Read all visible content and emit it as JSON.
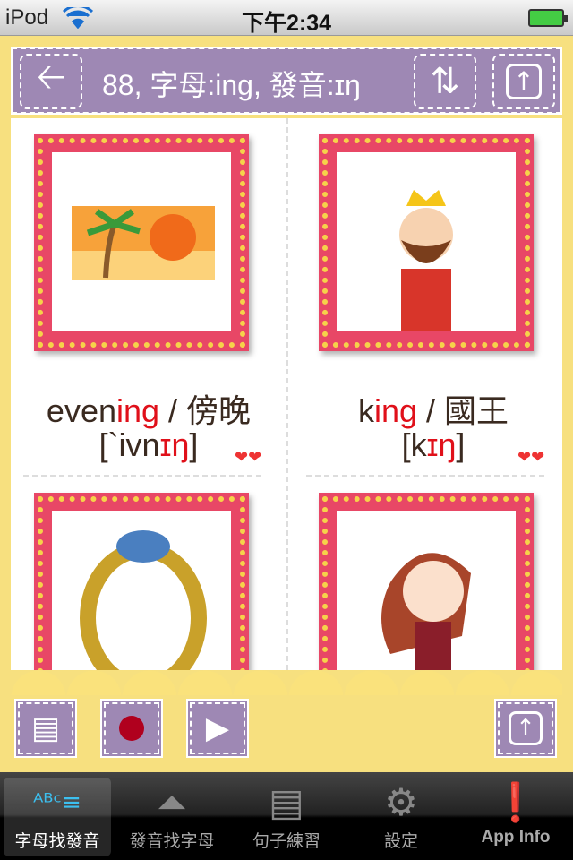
{
  "status": {
    "carrier": "iPod",
    "time": "下午2:34"
  },
  "header": {
    "title": "88, 字母:ing, 發音:ɪŋ"
  },
  "cards": [
    {
      "word_pre": "even",
      "word_hl": "ing",
      "meaning": " / 傍晚",
      "ipa_pre": "[`ivn",
      "ipa_hl": "ɪŋ",
      "ipa_post": "]",
      "image": "sunset"
    },
    {
      "word_pre": "k",
      "word_hl": "ing",
      "meaning": " / 國王",
      "ipa_pre": "[k",
      "ipa_hl": "ɪŋ",
      "ipa_post": "]",
      "image": "king"
    },
    {
      "image": "ring"
    },
    {
      "image": "singer-girl"
    }
  ],
  "tabs": [
    {
      "label": "字母找發音",
      "icon": "abc-books-icon"
    },
    {
      "label": "發音找字母",
      "icon": "lips-icon"
    },
    {
      "label": "句子練習",
      "icon": "document-icon"
    },
    {
      "label": "設定",
      "icon": "gear-icon"
    },
    {
      "label": "App Info",
      "icon": "info-icon"
    }
  ],
  "colors": {
    "accent": "#9e88b4",
    "highlight": "#e0101a",
    "background": "#f7e07f",
    "card": "#e84766"
  }
}
